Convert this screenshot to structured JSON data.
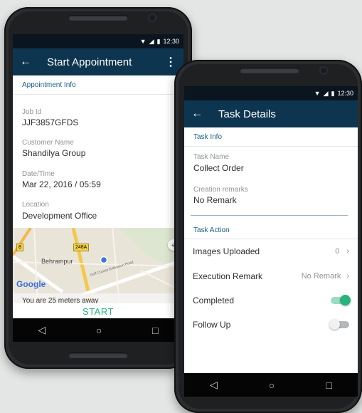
{
  "colors": {
    "appbar": "#0d3550",
    "accent": "#27b47c",
    "section": "#175f84"
  },
  "status": {
    "time": "12:30"
  },
  "phone1": {
    "title": "Start Appointment",
    "section": "Appointment Info",
    "fields": [
      {
        "label": "Job Id",
        "value": "JJF3857GFDS"
      },
      {
        "label": "Customer Name",
        "value": "Shandilya Group"
      },
      {
        "label": "Date/Time",
        "value": "Mar 22, 2016 / 05:59"
      },
      {
        "label": "Location",
        "value": "Development Office"
      }
    ],
    "map": {
      "place": "Behrampur",
      "route": "248A",
      "route2": "8",
      "road": "Golf Course Extension Road",
      "brand": "Google",
      "distance": "You are 25 meters away"
    },
    "start": "START"
  },
  "phone2": {
    "title": "Task Details",
    "section_info": "Task Info",
    "task_name_label": "Task Name",
    "task_name": "Collect Order",
    "remarks_label": "Creation remarks",
    "remarks": "No Remark",
    "section_action": "Task Action",
    "images_label": "Images Uploaded",
    "images_value": "0",
    "exec_label": "Execution Remark",
    "exec_value": "No Remark",
    "completed_label": "Completed",
    "completed": true,
    "follow_label": "Follow Up",
    "follow": false
  }
}
